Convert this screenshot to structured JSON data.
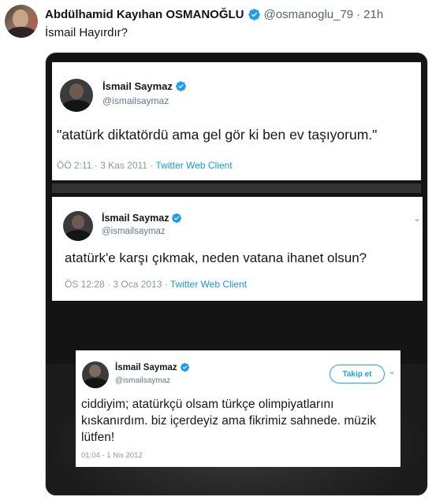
{
  "tweet": {
    "author_name": "Abdülhamid Kayıhan OSMANOĞLU",
    "handle": "@osmanoglu_79",
    "separator": "·",
    "time": "21h",
    "text": "İsmail Hayırdır?"
  },
  "screenshots": [
    {
      "name": "İsmail Saymaz",
      "handle": "@ismailsaymaz",
      "text": "\"atatürk diktatördü ama gel gör ki ben ev taşıyorum.\"",
      "meta": "ÖÖ 2:11 · 3 Kas 2011 · ",
      "client": "Twitter Web Client"
    },
    {
      "name": "İsmail Saymaz",
      "handle": "@ismailsaymaz",
      "text": "atatürk'e karşı çıkmak, neden vatana ihanet olsun?",
      "meta": "ÖS 12:28 · 3 Oca 2013 · ",
      "client": "Twitter Web Client"
    },
    {
      "name": "İsmail Saymaz",
      "handle": "@ismailsaymaz",
      "text": "ciddiyim; atatürkçü olsam türkçe olimpiyatlarını kıskanırdım. biz içerdeyiz ama fikrimiz sahnede. müzik lütfen!",
      "meta": "01:04 - 1 Nis 2012",
      "follow_label": "Takip et"
    }
  ],
  "colors": {
    "verified": "#1d9bf0",
    "link": "#1b95e0",
    "text": "#0f1419",
    "secondary": "#536471"
  },
  "icons": [
    "verified-badge-icon",
    "chevron-down-icon"
  ]
}
